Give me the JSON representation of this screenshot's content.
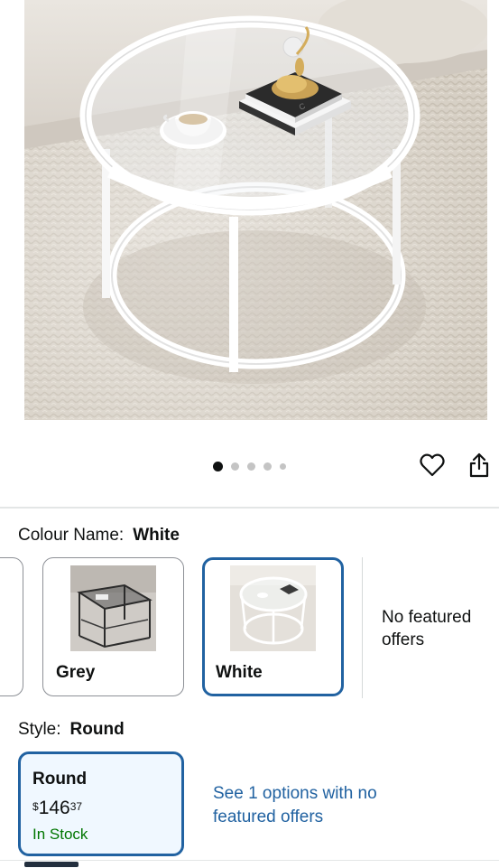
{
  "gallery": {
    "image_count": 5,
    "active_index": 0,
    "wishlist_icon": "heart-outline-icon",
    "share_icon": "share-icon"
  },
  "colour": {
    "label": "Colour Name:",
    "selected": "White",
    "options": [
      {
        "label": "Grey"
      },
      {
        "label": "White"
      }
    ],
    "no_offers": "No featured offers"
  },
  "style": {
    "label": "Style:",
    "selected": "Round",
    "card": {
      "name": "Round",
      "currency": "$",
      "price_whole": "146",
      "price_fraction": "37",
      "availability": "In Stock"
    },
    "see_options": "See 1 options with no featured offers"
  },
  "colors": {
    "accent": "#2162a1",
    "selected_bg": "#f0f8ff",
    "in_stock": "#007600"
  }
}
